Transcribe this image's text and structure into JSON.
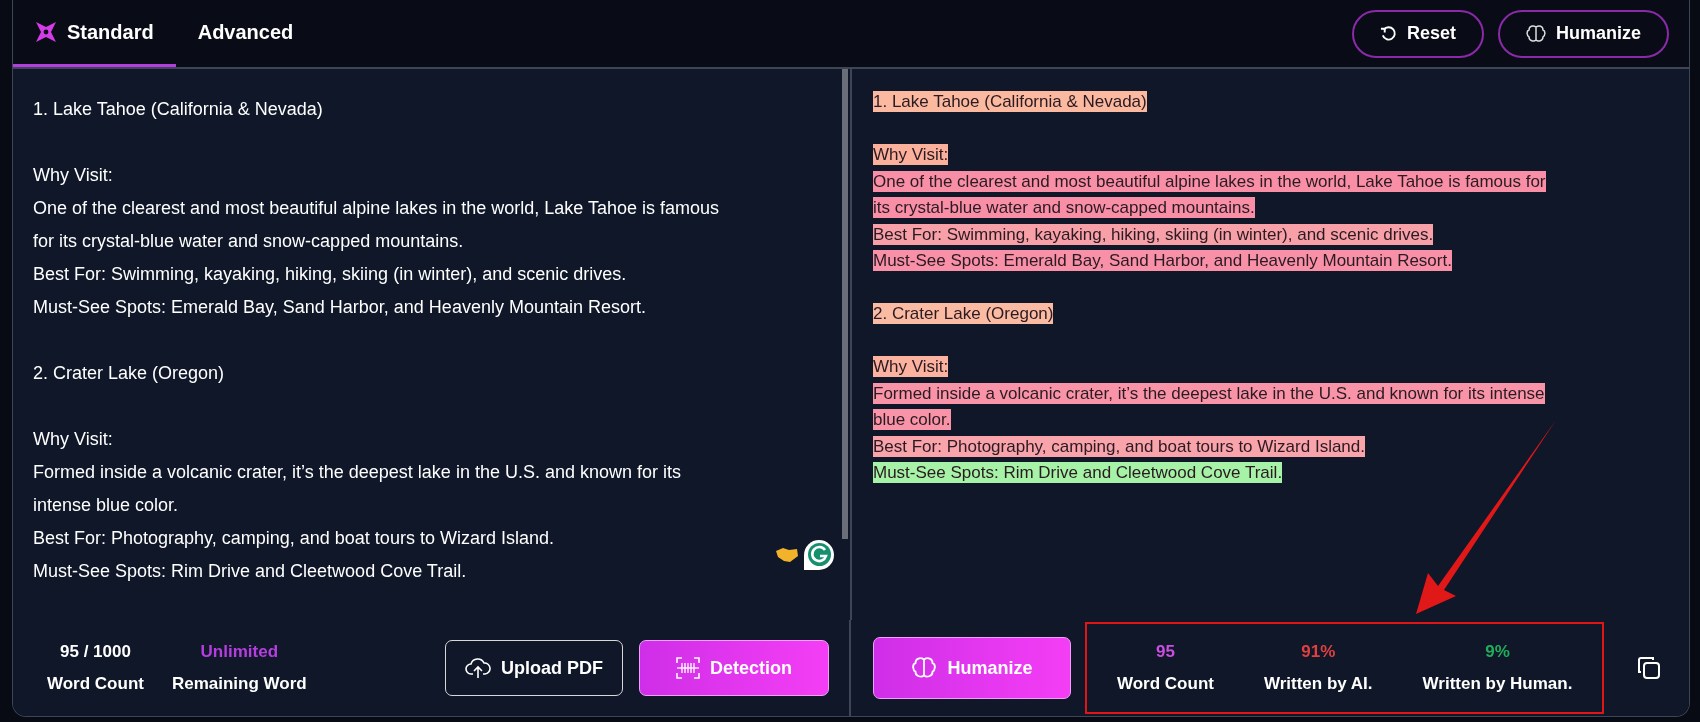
{
  "tabs": [
    {
      "label": "Standard",
      "selected": true
    },
    {
      "label": "Advanced",
      "selected": false
    }
  ],
  "header_buttons": [
    {
      "label": "Reset",
      "kind": "reset"
    },
    {
      "label": "Humanize",
      "kind": "humanize"
    }
  ],
  "input": {
    "paragraphs": [
      [
        "1. Lake Tahoe (California & Nevada)"
      ],
      [
        "Why Visit:",
        "One of the clearest and most beautiful alpine lakes in the world, Lake Tahoe is famous for its crystal-blue water and snow-capped mountains.",
        "Best For: Swimming, kayaking, hiking, skiing (in winter), and scenic drives.",
        "Must-See Spots: Emerald Bay, Sand Harbor, and Heavenly Mountain Resort."
      ],
      [
        "2. Crater Lake (Oregon)"
      ],
      [
        "Why Visit:",
        "Formed inside a volcanic crater, it’s the deepest lake in the U.S. and known for its intense blue color.",
        "Best For: Photography, camping, and boat tours to Wizard Island.",
        "Must-See Spots: Rim Drive and Cleetwood Cove Trail."
      ]
    ],
    "stats": [
      {
        "value": "95 / 1000",
        "label": "Word Count",
        "color": "#ffffff"
      },
      {
        "value": "Unlimited",
        "label": "Remaining Word",
        "color": "#b63ee0"
      }
    ],
    "buttons": [
      {
        "label": "Upload PDF",
        "kind": "outline"
      },
      {
        "label": "Detection",
        "kind": "primary"
      }
    ]
  },
  "output": {
    "paragraphs": [
      [
        {
          "text": "1. Lake Tahoe (California & Nevada)",
          "color": "#fbb9a0"
        }
      ],
      [
        {
          "text": "Why Visit:",
          "color": "#fbb09c"
        },
        {
          "text": "One of the clearest and most beautiful alpine lakes in the world, Lake Tahoe is famous for",
          "color": "#f98fa6"
        },
        {
          "text": "its crystal-blue water and snow-capped mountains.",
          "color": "#f98fa6"
        },
        {
          "text": "Best For: Swimming, kayaking, hiking, skiing (in winter), and scenic drives.",
          "color": "#f8a0a8"
        },
        {
          "text": "Must-See Spots: Emerald Bay, Sand Harbor, and Heavenly Mountain Resort.",
          "color": "#f890a8"
        }
      ],
      [
        {
          "text": "2. Crater Lake (Oregon)",
          "color": "#fbbba2"
        }
      ],
      [
        {
          "text": "Why Visit:",
          "color": "#fbb29e"
        },
        {
          "text": "Formed inside a volcanic crater, it’s the deepest lake in the U.S. and known for its intense",
          "color": "#f994a8"
        },
        {
          "text": "blue color.",
          "color": "#f994a8"
        },
        {
          "text": "Best For: Photography, camping, and boat tours to Wizard Island.",
          "color": "#f9a3ab"
        },
        {
          "text": "Must-See Spots: Rim Drive and Cleetwood Cove Trail.",
          "color": "#a6f2a6"
        }
      ]
    ],
    "button": {
      "label": "Humanize"
    },
    "stats": [
      {
        "value": "95",
        "label": "Word Count",
        "color": "#c94fe0"
      },
      {
        "value": "91%",
        "label": "Written by AI.",
        "color": "#e0403f"
      },
      {
        "value": "9%",
        "label": "Written by Human.",
        "color": "#1fae5a"
      }
    ]
  }
}
